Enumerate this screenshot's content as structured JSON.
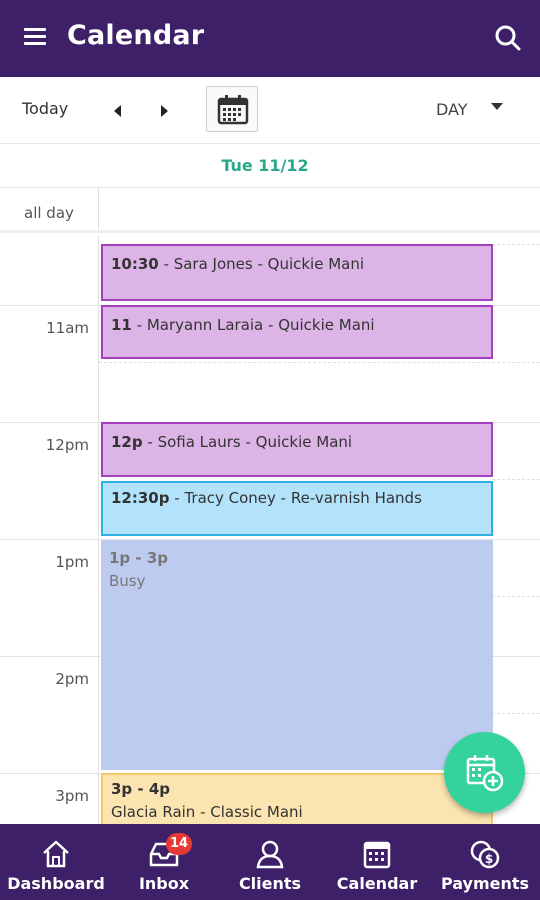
{
  "appbar": {
    "title": "Calendar",
    "menu_icon": "menu-icon",
    "search_icon": "search-icon",
    "background": "#3d2068"
  },
  "toolbar": {
    "today_label": "Today",
    "prev_icon": "chevron-left-icon",
    "next_icon": "chevron-right-icon",
    "date_picker_icon": "calendar-icon",
    "view_mode": "DAY"
  },
  "date_header": {
    "date": "Tue 11/12",
    "color": "#2aa889"
  },
  "allday": {
    "label": "all day"
  },
  "times": [
    "11am",
    "12pm",
    "1pm",
    "2pm",
    "3pm"
  ],
  "events": [
    {
      "time": "10:30",
      "sep": " - ",
      "text": "Sara Jones - Quickie Mani",
      "style": "purple"
    },
    {
      "time": "11",
      "sep": " - ",
      "text": "Maryann Laraia - Quickie Mani",
      "style": "purple"
    },
    {
      "time": "12p",
      "sep": " - ",
      "text": "Sofia Laurs - Quickie Mani",
      "style": "purple"
    },
    {
      "time": "12:30p",
      "sep": " - ",
      "text": "Tracy Coney - Re-varnish Hands",
      "style": "blue"
    },
    {
      "time": "1p - 3p",
      "sep": "",
      "text": "Busy",
      "style": "busy"
    },
    {
      "time": "3p - 4p",
      "sep": "",
      "text": "Glacia Rain - Classic Mani",
      "style": "yellow"
    }
  ],
  "fab": {
    "icon": "add-appointment-icon",
    "color": "#34d39e"
  },
  "bottom_nav": {
    "items": [
      {
        "label": "Dashboard",
        "icon": "home-icon"
      },
      {
        "label": "Inbox",
        "icon": "inbox-icon",
        "badge": "14"
      },
      {
        "label": "Clients",
        "icon": "clients-icon"
      },
      {
        "label": "Calendar",
        "icon": "calendar-icon"
      },
      {
        "label": "Payments",
        "icon": "payments-icon"
      }
    ]
  }
}
